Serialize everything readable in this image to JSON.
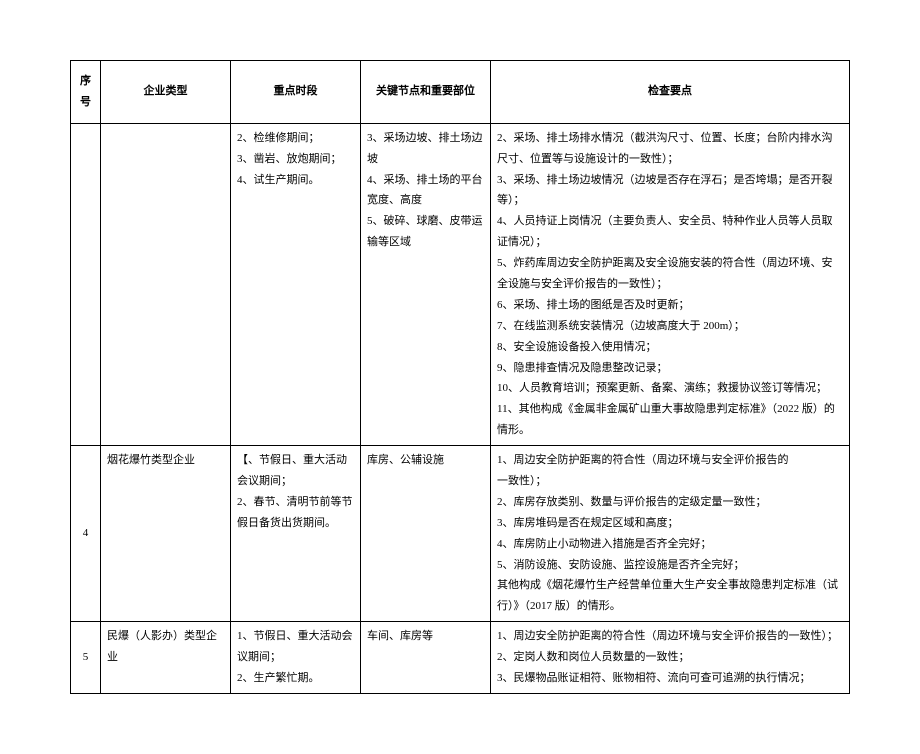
{
  "headers": {
    "seq": "序号",
    "type": "企业类型",
    "period": "重点时段",
    "keynode": "关键节点和重要部位",
    "checkpoints": "检查要点"
  },
  "rows": [
    {
      "seq": "",
      "type": "",
      "period": "2、检维修期间；\n3、凿岩、放炮期间；\n4、试生产期间。",
      "keynode": "3、采场边坡、排土场边坡\n4、采场、排土场的平台宽度、高度\n5、破碎、球磨、皮带运输等区域",
      "checkpoints": "2、采场、排土场排水情况（截洪沟尺寸、位置、长度；台阶内排水沟尺寸、位置等与设施设计的一致性）；\n3、采场、排土场边坡情况（边坡是否存在浮石；是否垮塌；是否开裂等）；\n4、人员持证上岗情况（主要负责人、安全员、特种作业人员等人员取证情况）；\n5、炸药库周边安全防护距离及安全设施安装的符合性（周边环境、安全设施与安全评价报告的一致性）；\n6、采场、排土场的图纸是否及时更新；\n7、在线监测系统安装情况（边坡高度大于 200m）；\n8、安全设施设备投入使用情况；\n9、隐患排查情况及隐患整改记录；\n10、人员教育培训；预案更新、备案、演练；救援协议签订等情况；11、其他构成《金属非金属矿山重大事故隐患判定标准》（2022 版）的情形。"
    },
    {
      "seq": "4",
      "type": "烟花爆竹类型企业",
      "period": "【、节假日、重大活动会议期间；\n2、春节、清明节前等节假日备货出货期间。",
      "keynode": "库房、公辅设施",
      "checkpoints": "1、周边安全防护距离的符合性（周边环境与安全评价报告的\n一致性）；\n2、库房存放类别、数量与评价报告的定级定量一致性；\n3、库房堆码是否在规定区域和高度；\n4、库房防止小动物进入措施是否齐全完好；\n5、消防设施、安防设施、监控设施是否齐全完好；\n其他构成《烟花爆竹生产经营单位重大生产安全事故隐患判定标准（试行）》（2017 版）的情形。"
    },
    {
      "seq": "5",
      "type": "民爆（人影办）类型企业",
      "period": "1、节假日、重大活动会议期间；\n2、生产繁忙期。",
      "keynode": "车间、库房等",
      "checkpoints": "1、周边安全防护距离的符合性（周边环境与安全评价报告的一致性）；\n2、定岗人数和岗位人员数量的一致性；\n3、民爆物品账证相符、账物相符、流向可查可追溯的执行情况；"
    }
  ]
}
